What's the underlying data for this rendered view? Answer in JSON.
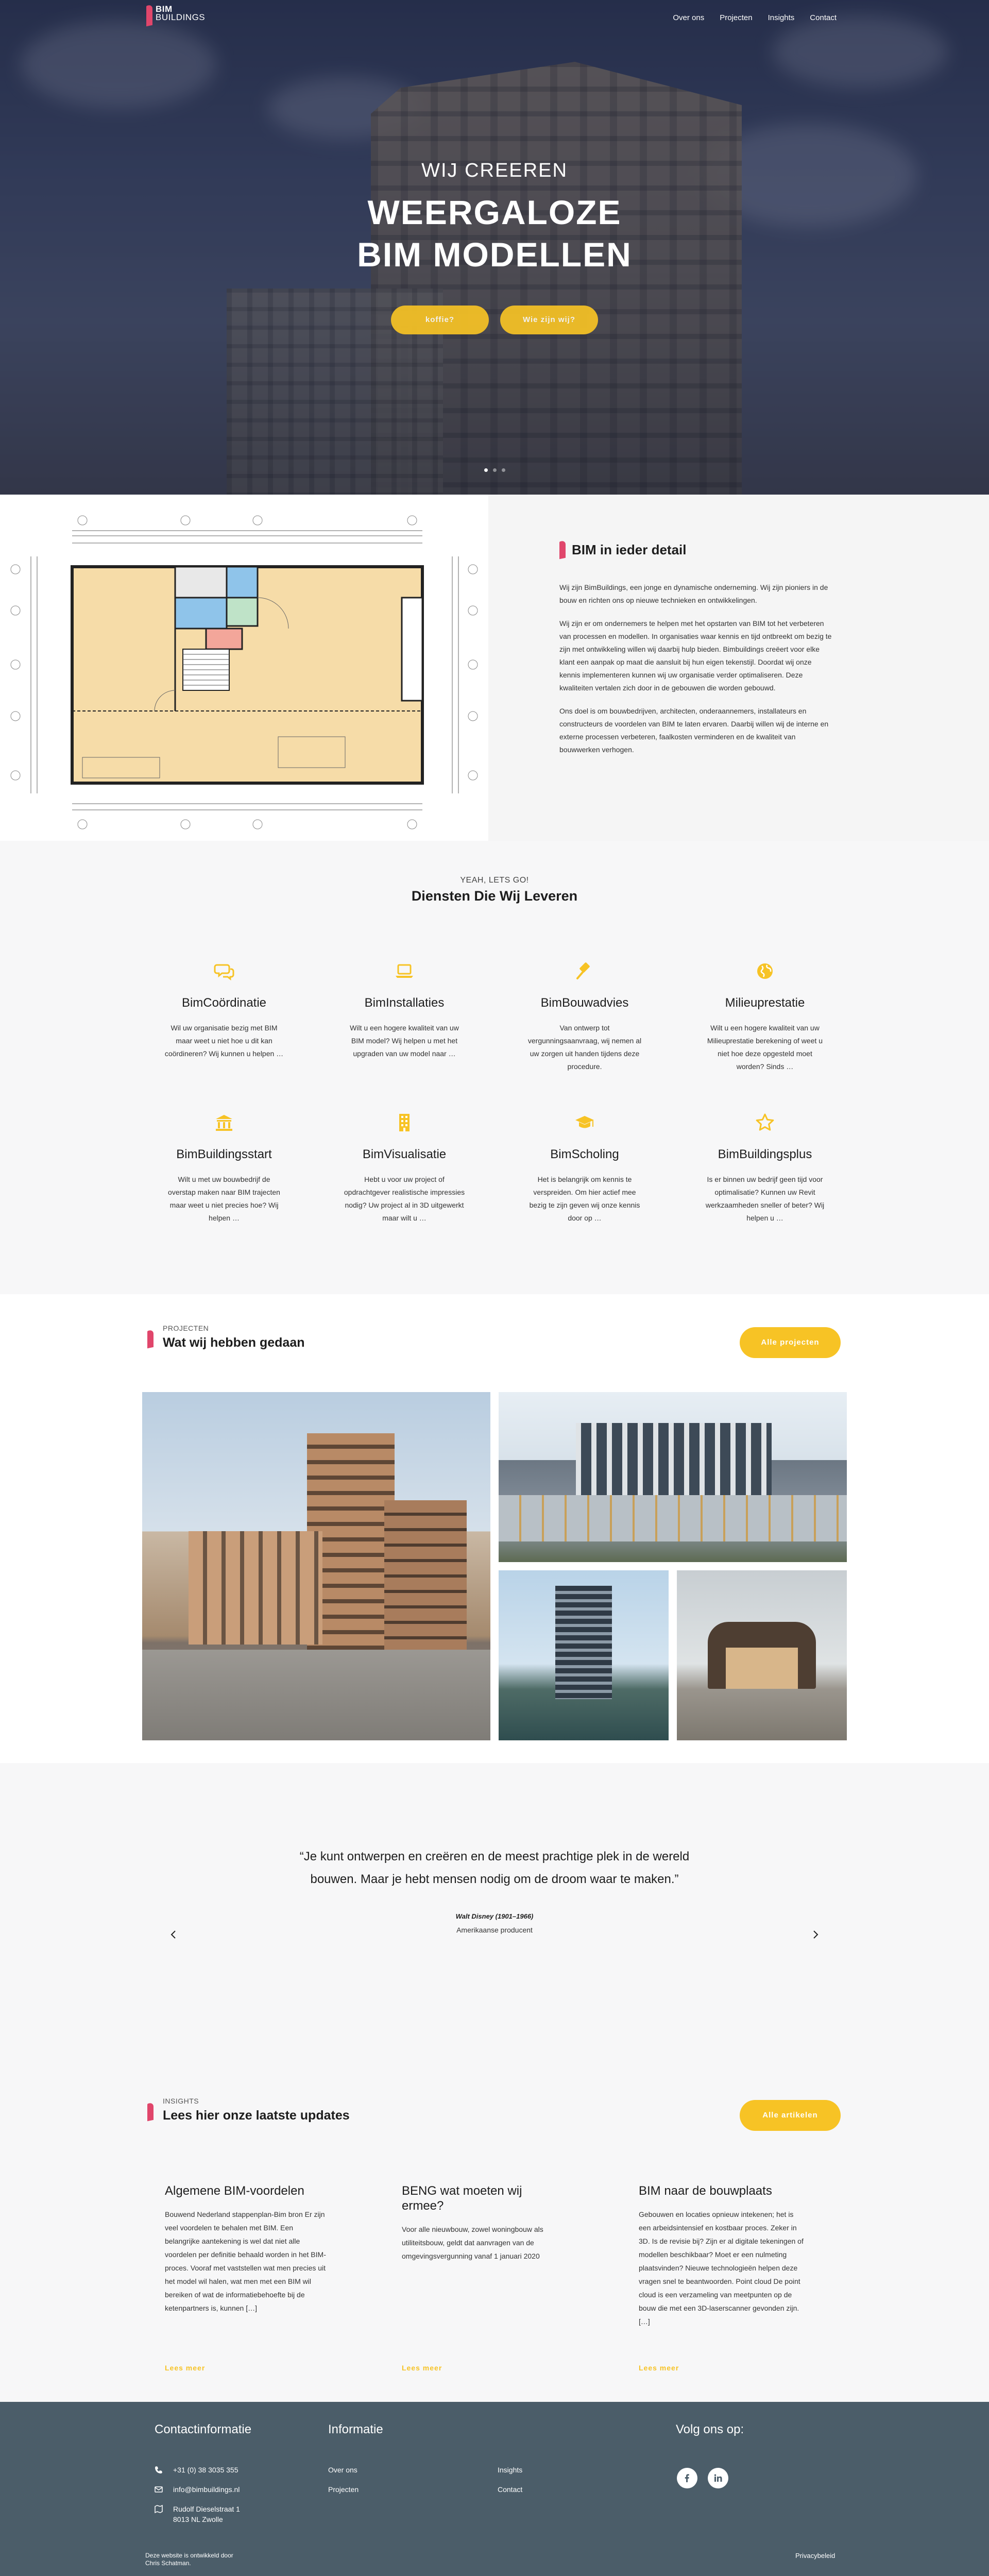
{
  "brand": {
    "line1": "BIM",
    "line2": "BUILDINGS"
  },
  "nav": {
    "items": [
      "Over ons",
      "Projecten",
      "Insights",
      "Contact"
    ]
  },
  "hero": {
    "pre": "WIJ CREEREN",
    "title_line1": "WEERGALOZE",
    "title_line2": "BIM MODELLEN",
    "btn_primary": "koffie?",
    "btn_secondary": "Wie zijn wij?",
    "slides": 3,
    "active_slide": 1
  },
  "detail": {
    "title": "BIM in ieder detail",
    "p1": "Wij zijn BimBuildings, een jonge en dynamische onderneming. Wij zijn pioniers in de bouw en richten ons op nieuwe technieken en ontwikkelingen.",
    "p2": "Wij zijn er om ondernemers te helpen met het opstarten van BIM tot het verbeteren van processen en modellen. In organisaties waar kennis en tijd ontbreekt om bezig te zijn met ontwikkeling willen wij daarbij hulp bieden. Bimbuildings creëert voor elke klant een aanpak op maat die aansluit bij hun eigen tekenstijl. Doordat wij onze kennis implementeren kunnen wij uw organisatie verder optimaliseren. Deze kwaliteiten vertalen zich door in de gebouwen die worden gebouwd.",
    "p3": "Ons doel is om bouwbedrijven, architecten, onderaannemers, installateurs en constructeurs de voordelen van BIM te laten ervaren. Daarbij willen wij de interne en externe processen verbeteren, faalkosten verminderen en de kwaliteit van bouwwerken verhogen."
  },
  "services": {
    "pre": "YEAH, LETS GO!",
    "title": "Diensten Die Wij Leveren",
    "items": [
      {
        "title": "BimCoördinatie",
        "text": "Wil uw organisatie bezig met BIM maar weet u niet hoe u dit kan coördineren? Wij kunnen u helpen …",
        "icon": "comments-icon"
      },
      {
        "title": "BimInstallaties",
        "text": "Wilt u een hogere kwaliteit van uw BIM model? Wij helpen u met het upgraden van uw model naar …",
        "icon": "laptop-icon"
      },
      {
        "title": "BimBouwadvies",
        "text": "Van ontwerp tot vergunningsaanvraag, wij nemen al uw zorgen uit handen tijdens deze procedure.",
        "icon": "gavel-icon"
      },
      {
        "title": "Milieuprestatie",
        "text": "Wilt u een hogere kwaliteit van uw Milieuprestatie berekening of weet u niet hoe deze opgesteld moet worden? Sinds …",
        "icon": "globe-icon"
      },
      {
        "title": "BimBuildingsstart",
        "text": "Wilt u met uw bouwbedrijf de overstap maken naar BIM trajecten maar weet u niet precies hoe? Wij helpen …",
        "icon": "bank-icon"
      },
      {
        "title": "BimVisualisatie",
        "text": "Hebt u voor uw project of opdrachtgever realistische impressies nodig? Uw project al in 3D uitgewerkt maar wilt u …",
        "icon": "building-icon"
      },
      {
        "title": "BimScholing",
        "text": "Het is belangrijk om kennis te verspreiden. Om hier actief mee bezig te zijn geven wij onze kennis door op …",
        "icon": "graduation-cap-icon"
      },
      {
        "title": "BimBuildingsplus",
        "text": "Is er binnen uw bedrijf geen tijd voor optimalisatie? Kunnen uw Revit werkzaamheden sneller of beter? Wij helpen u …",
        "icon": "star-icon"
      }
    ]
  },
  "projects": {
    "pre": "PROJECTEN",
    "title": "Wat wij hebben gedaan",
    "button": "Alle projecten"
  },
  "quote": {
    "line1": "“Je kunt ontwerpen en creëren en de meest prachtige plek in de wereld",
    "line2": "bouwen. Maar je hebt mensen nodig om de droom waar te maken.”",
    "author": "Walt Disney (1901–1966)",
    "role": "Amerikaanse producent"
  },
  "insights": {
    "pre": "INSIGHTS",
    "title": "Lees hier onze laatste updates",
    "button": "Alle artikelen",
    "articles": [
      {
        "title": "Algemene BIM-voordelen",
        "text": "Bouwend Nederland stappenplan-Bim bron Er zijn veel voordelen te behalen met BIM. Een belangrijke aantekening is wel dat niet alle voordelen per definitie behaald worden in het BIM-proces. Vooraf met vaststellen wat men precies uit het model wil halen, wat men met een BIM wil bereiken of wat de informatiebehoefte bij de ketenpartners is, kunnen […]",
        "more": "Lees meer"
      },
      {
        "title": "BENG wat moeten wij ermee?",
        "text": "Voor alle nieuwbouw, zowel woningbouw als utiliteitsbouw, geldt dat aanvragen van de omgevingsvergunning vanaf 1 januari 2020",
        "more": "Lees meer"
      },
      {
        "title": "BIM naar de bouwplaats",
        "text": "Gebouwen en locaties opnieuw intekenen; het is een arbeidsintensief en kostbaar proces. Zeker in 3D. Is de revisie bij? Zijn er al digitale tekeningen of modellen beschikbaar? Moet er een nulmeting plaatsvinden? Nieuwe technologieën helpen deze vragen snel te beantwoorden. Point cloud De point cloud is een verzameling van meetpunten op de bouw die met een 3D-laserscanner gevonden zijn. […]",
        "more": "Lees meer"
      }
    ]
  },
  "footer": {
    "contact_title": "Contactinformatie",
    "phone": "+31 (0) 38 3035 355",
    "email": "info@bimbuildings.nl",
    "address1": "Rudolf Dieselstraat 1",
    "address2": "8013 NL Zwolle",
    "info_title": "Informatie",
    "links": [
      "Over ons",
      "Projecten",
      "Insights",
      "Contact"
    ],
    "follow_title": "Volg ons op:",
    "credit_line1": "Deze website is ontwikkeld door",
    "credit_line2": "Chris Schatman.",
    "privacy": "Privacybeleid"
  },
  "colors": {
    "accent": "#f7c325",
    "brand": "#e0466b",
    "footer": "#4b5d69"
  }
}
